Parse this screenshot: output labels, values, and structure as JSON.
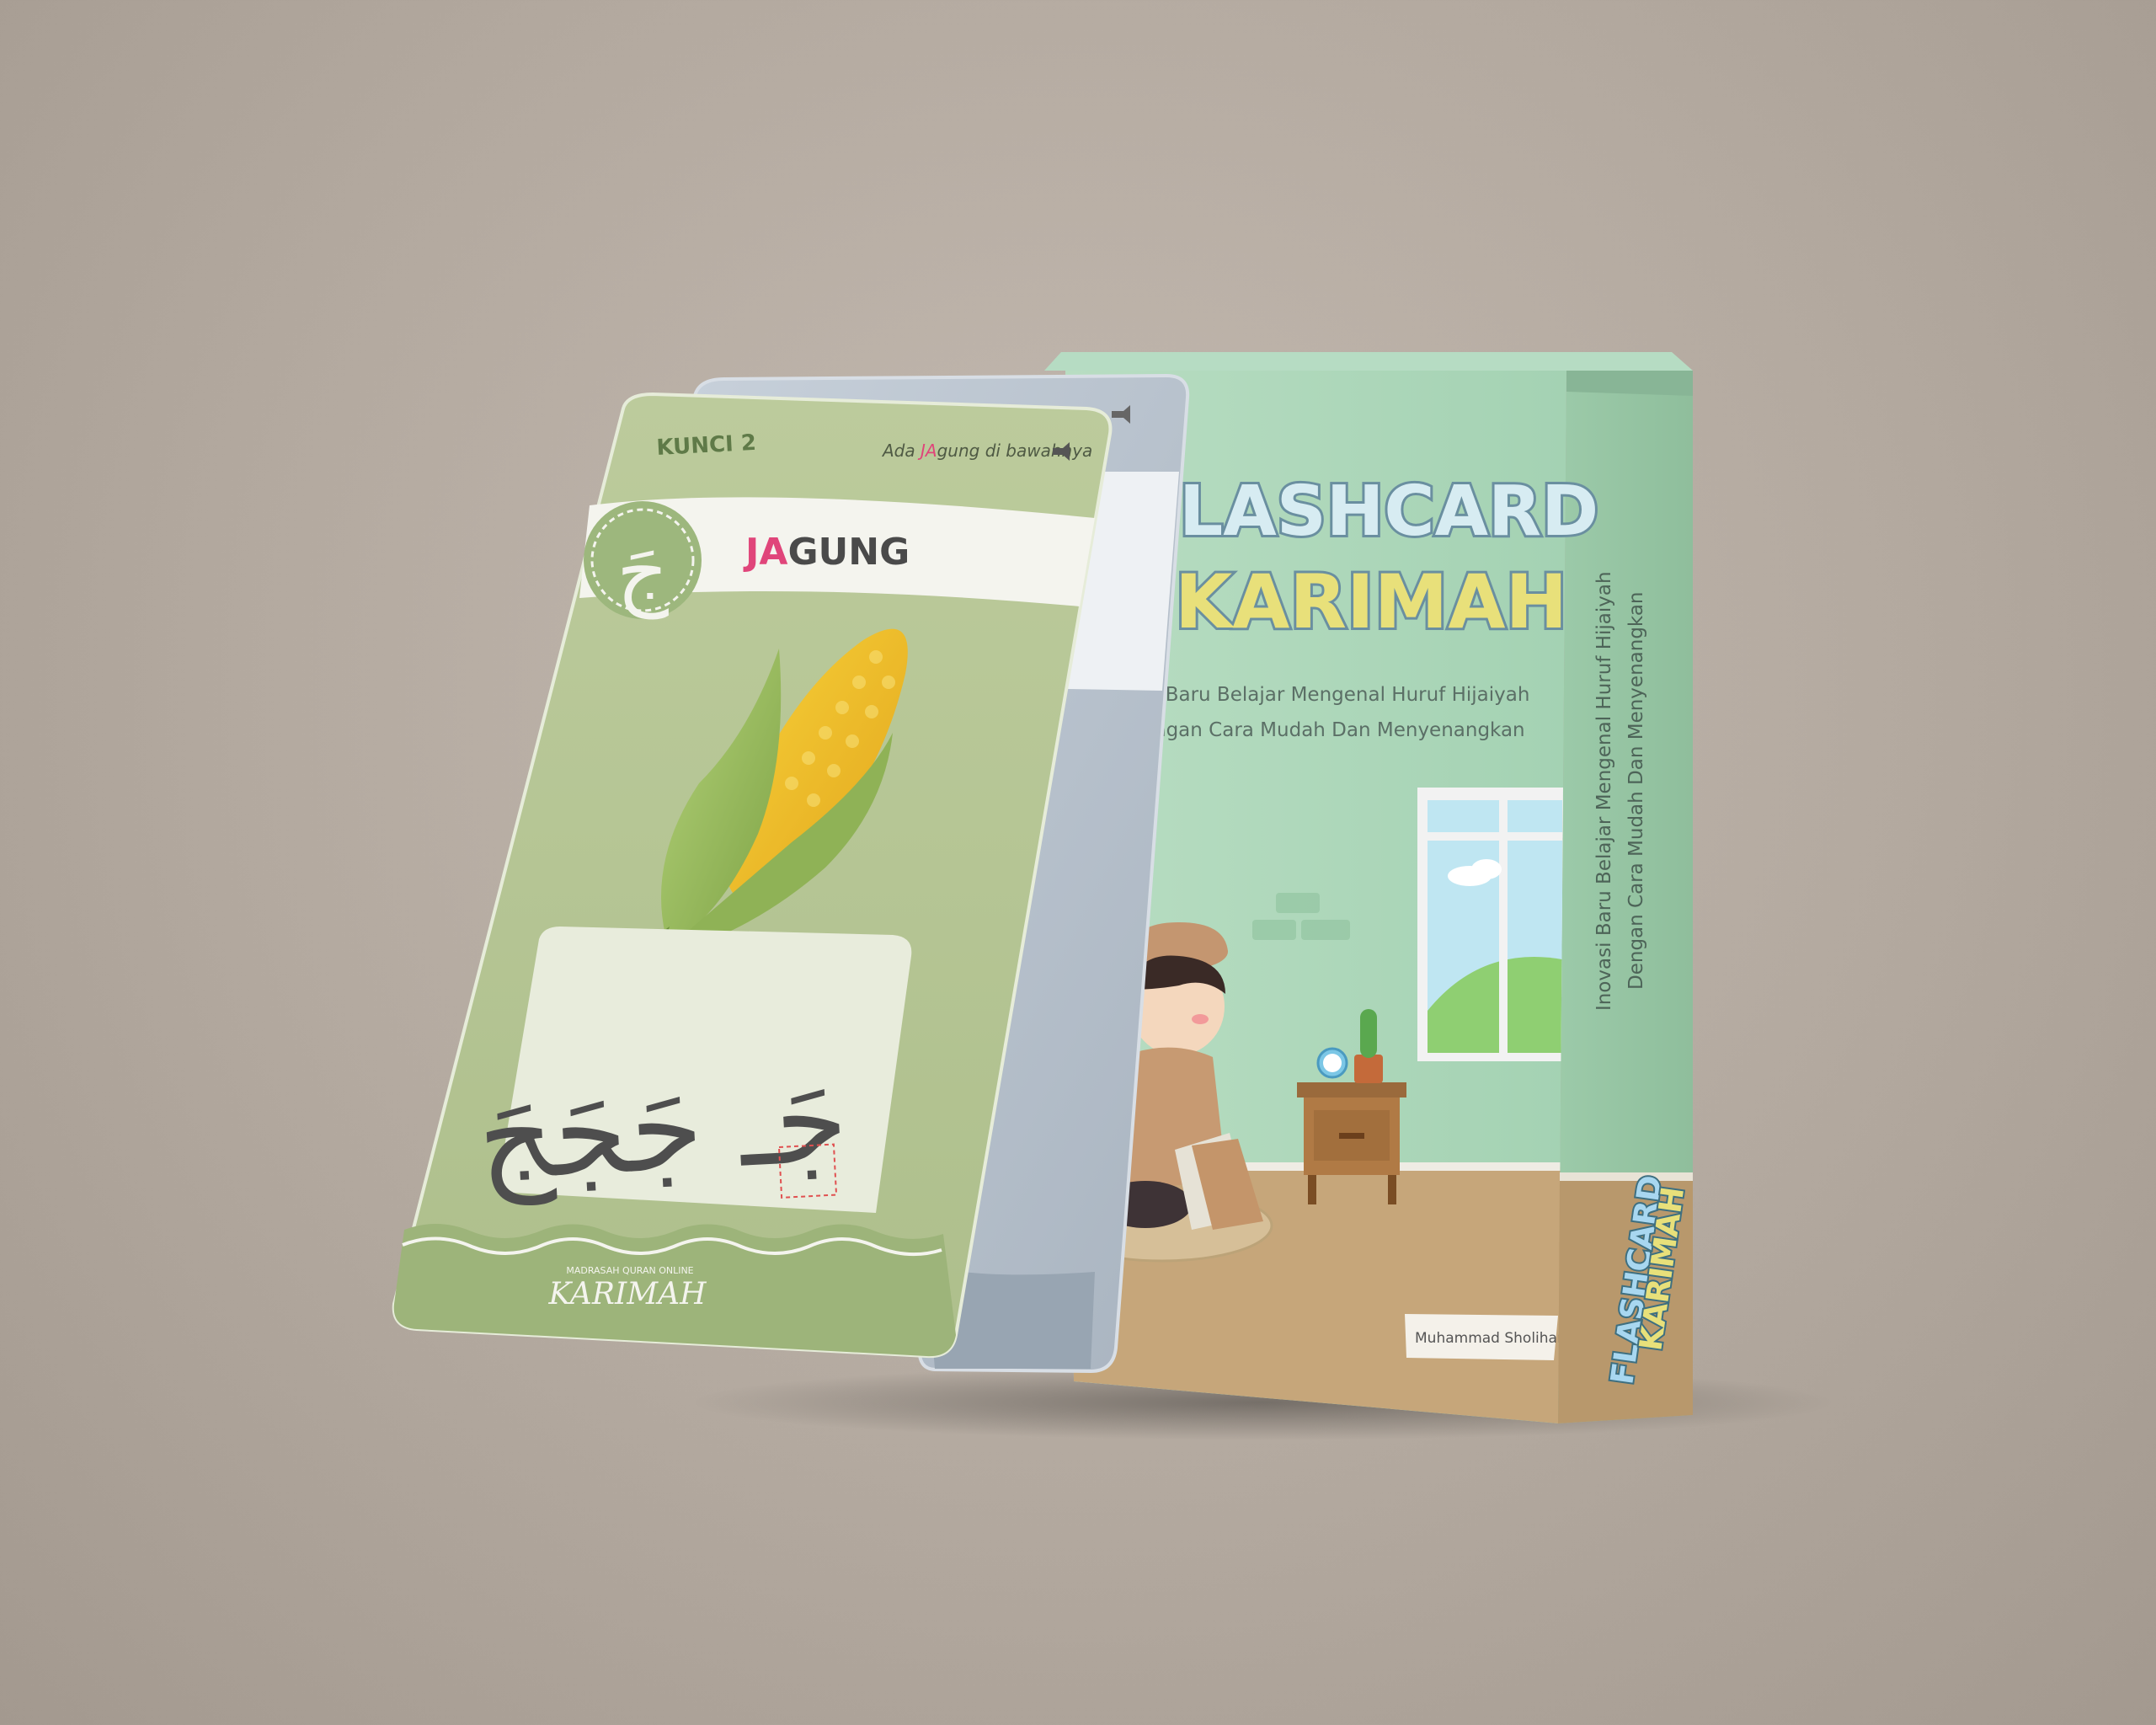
{
  "front_card": {
    "kunci_label": "KUNCI 2",
    "letter": "جَ",
    "hint_prefix": "Ada ",
    "hint_highlight": "JA",
    "hint_suffix": "gung di bawahnya",
    "word_highlight": "JA",
    "word_rest": "GUNG",
    "letter_forms": "جَـ جَجَجَ",
    "brand_small": "MADRASAH QURAN ONLINE",
    "brand": "KARIMAH"
  },
  "box": {
    "title_line1": "LASHCARD",
    "title_line2": "KARIMAH",
    "subtitle_line1": "i Baru Belajar Mengenal Huruf Hijaiyah",
    "subtitle_line2": "ngan Cara Mudah Dan Menyenangkan",
    "author": "Muhammad Sholihan",
    "side_text_line1": "Inovasi Baru Belajar Mengenal Huruf Hijaiyah",
    "side_text_line2": "Dengan Cara Mudah Dan Menyenangkan",
    "side_logo_line1": "FLASHCARD",
    "side_logo_line2": "KARIMAH"
  },
  "colors": {
    "card_green": "#b9c99a",
    "card_green_dark": "#9db47a",
    "box_mint": "#a9d5b6",
    "box_floor": "#c7a77a",
    "highlight_pink": "#e0457a",
    "title_yellow": "#e8e07a"
  }
}
